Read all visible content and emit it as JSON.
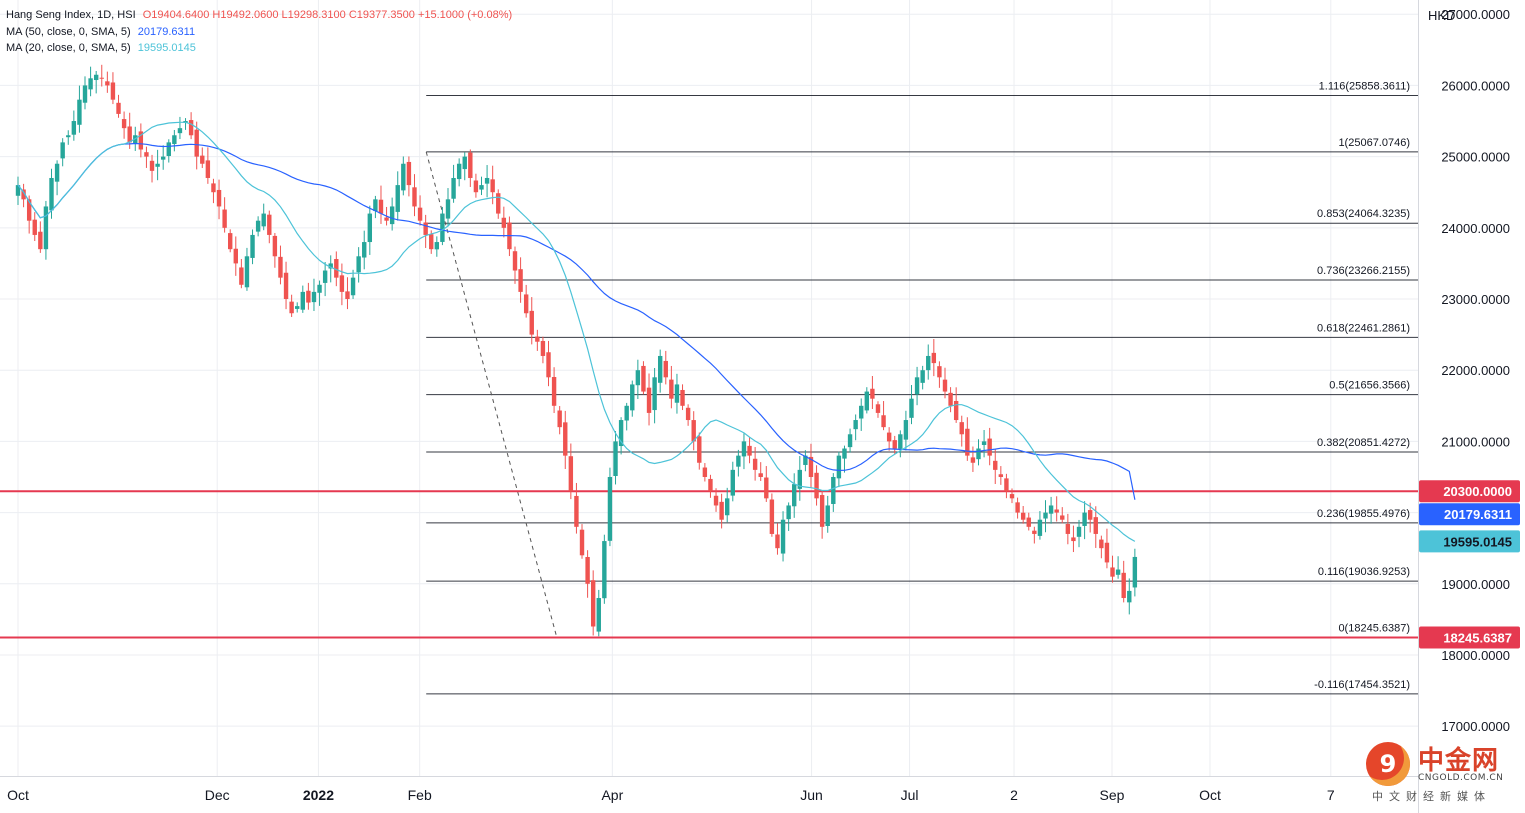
{
  "legend": {
    "title": "Hang Seng Index, 1D, HSI",
    "ohlc": "O19404.6400  H19492.0600  L19298.3100  C19377.3500  +15.1000 (+0.08%)",
    "ma50_label": "MA (50, close, 0, SMA, 5)",
    "ma50_value": "20179.6311",
    "ma20_label": "MA (20, close, 0, SMA, 5)",
    "ma20_value": "19595.0145"
  },
  "colors": {
    "up": "#26a69a",
    "down": "#ef5350",
    "ma50": "#2962ff",
    "ma20": "#4dc3d8",
    "hline": "#e53950",
    "fib": "#131722",
    "grid": "#eceef2"
  },
  "logo": {
    "title": "中金网",
    "url": "CNGOLD.COM.CN",
    "sub": "中文财经新媒体",
    "icon": "cngold-logo-icon"
  },
  "chart_data": {
    "type": "candlestick",
    "currency_label": "HKD",
    "ylim": [
      16300,
      27200
    ],
    "y_ticks": [
      "17000.0000",
      "18000.0000",
      "19000.0000",
      "20000.0000",
      "21000.0000",
      "22000.0000",
      "23000.0000",
      "24000.0000",
      "25000.0000",
      "26000.0000",
      "27000.0000"
    ],
    "y_tick_values": [
      17000,
      18000,
      19000,
      20000,
      21000,
      22000,
      23000,
      24000,
      25000,
      26000,
      27000
    ],
    "x_ticks": [
      {
        "label": "Oct",
        "bold": false,
        "date": "2021-10-01"
      },
      {
        "label": "Dec",
        "bold": false,
        "date": "2021-12-01"
      },
      {
        "label": "2022",
        "bold": true,
        "date": "2022-01-01"
      },
      {
        "label": "Feb",
        "bold": false,
        "date": "2022-02-01"
      },
      {
        "label": "Apr",
        "bold": false,
        "date": "2022-04-01"
      },
      {
        "label": "Jun",
        "bold": false,
        "date": "2022-06-01"
      },
      {
        "label": "Jul",
        "bold": false,
        "date": "2022-07-01"
      },
      {
        "label": "2",
        "bold": false,
        "date": "2022-08-02"
      },
      {
        "label": "Sep",
        "bold": false,
        "date": "2022-09-01"
      },
      {
        "label": "Oct",
        "bold": false,
        "date": "2022-10-01"
      },
      {
        "label": "7",
        "bold": false,
        "date": "2022-11-07"
      }
    ],
    "fib_levels": [
      {
        "label": "1.116(25858.3611)",
        "value": 25858.3611
      },
      {
        "label": "1(25067.0746)",
        "value": 25067.0746
      },
      {
        "label": "0.853(24064.3235)",
        "value": 24064.3235
      },
      {
        "label": "0.736(23266.2155)",
        "value": 23266.2155
      },
      {
        "label": "0.618(22461.2861)",
        "value": 22461.2861
      },
      {
        "label": "0.5(21656.3566)",
        "value": 21656.3566
      },
      {
        "label": "0.382(20851.4272)",
        "value": 20851.4272
      },
      {
        "label": "0.236(19855.4976)",
        "value": 19855.4976
      },
      {
        "label": "0.116(19036.9253)",
        "value": 19036.9253
      },
      {
        "label": "0(18245.6387)",
        "value": 18245.6387
      },
      {
        "label": "-0.116(17454.3521)",
        "value": 17454.3521
      }
    ],
    "fib_trend": {
      "from": {
        "date": "2022-02-03",
        "value": 25067.0746
      },
      "to": {
        "date": "2022-03-15",
        "value": 18245.6387
      }
    },
    "horizontal_lines": [
      {
        "label": "20300.0000",
        "value": 20300
      },
      {
        "label": "18245.6387",
        "value": 18245.6387
      }
    ],
    "price_tags": [
      {
        "label": "20300.0000",
        "value": 20300,
        "kind": "hline"
      },
      {
        "label": "20179.6311",
        "value": 20179.6311,
        "kind": "ma50"
      },
      {
        "label": "19595.0145",
        "value": 19595.0145,
        "kind": "ma20"
      },
      {
        "label": "18245.6387",
        "value": 18245.6387,
        "kind": "hline"
      }
    ],
    "series": [
      {
        "name": "Hang Seng Index",
        "kind": "candles",
        "x_start": "2021-10-01",
        "x_end": "2022-09-08",
        "closes": [
          24600,
          24400,
          24100,
          23900,
          23700,
          24300,
          24700,
          24900,
          25200,
          25300,
          25500,
          25800,
          26000,
          26100,
          26150,
          26100,
          26000,
          25800,
          25600,
          25400,
          25200,
          25300,
          25100,
          25000,
          24800,
          24900,
          25000,
          25200,
          25300,
          25400,
          25500,
          25300,
          25000,
          24900,
          24700,
          24500,
          24300,
          24000,
          23700,
          23500,
          23200,
          23600,
          23900,
          24100,
          24200,
          23900,
          23600,
          23300,
          23000,
          22800,
          22900,
          23100,
          22950,
          23100,
          23200,
          23400,
          23500,
          23300,
          23100,
          23000,
          23300,
          23600,
          23800,
          24200,
          24400,
          24200,
          24100,
          24300,
          24600,
          24900,
          24600,
          24300,
          24100,
          23900,
          23700,
          23800,
          24200,
          24400,
          24700,
          24900,
          25000,
          24700,
          24500,
          24600,
          24700,
          24500,
          24200,
          24000,
          23700,
          23400,
          23100,
          22800,
          22500,
          22400,
          22200,
          21900,
          21500,
          21200,
          20800,
          20300,
          19800,
          19400,
          19000,
          18400,
          18800,
          19600,
          20500,
          21000,
          21300,
          21500,
          21800,
          22000,
          21700,
          21400,
          21900,
          22200,
          21900,
          21600,
          21800,
          21500,
          21300,
          21000,
          20700,
          20500,
          20300,
          20100,
          19900,
          20200,
          20600,
          20800,
          21000,
          20800,
          20600,
          20500,
          20200,
          19700,
          19500,
          19900,
          20100,
          20400,
          20600,
          20800,
          20500,
          20200,
          19800,
          20100,
          20500,
          20800,
          20900,
          21100,
          21300,
          21500,
          21700,
          21600,
          21400,
          21200,
          21000,
          20900,
          21100,
          21300,
          21600,
          21900,
          22000,
          22200,
          22100,
          21900,
          21700,
          21500,
          21300,
          21100,
          20800,
          20700,
          20900,
          21000,
          20800,
          20600,
          20500,
          20300,
          20200,
          20000,
          19900,
          19800,
          19700,
          19900,
          20000,
          20100,
          20000,
          19900,
          19700,
          19600,
          19800,
          20000,
          19900,
          19700,
          19500,
          19300,
          19100,
          19200,
          18800,
          18900,
          19377
        ]
      },
      {
        "name": "MA (50, close, 0, SMA, 5)",
        "kind": "line",
        "value": "20179.6311"
      },
      {
        "name": "MA (20, close, 0, SMA, 5)",
        "kind": "line",
        "value": "19595.0145"
      }
    ]
  }
}
